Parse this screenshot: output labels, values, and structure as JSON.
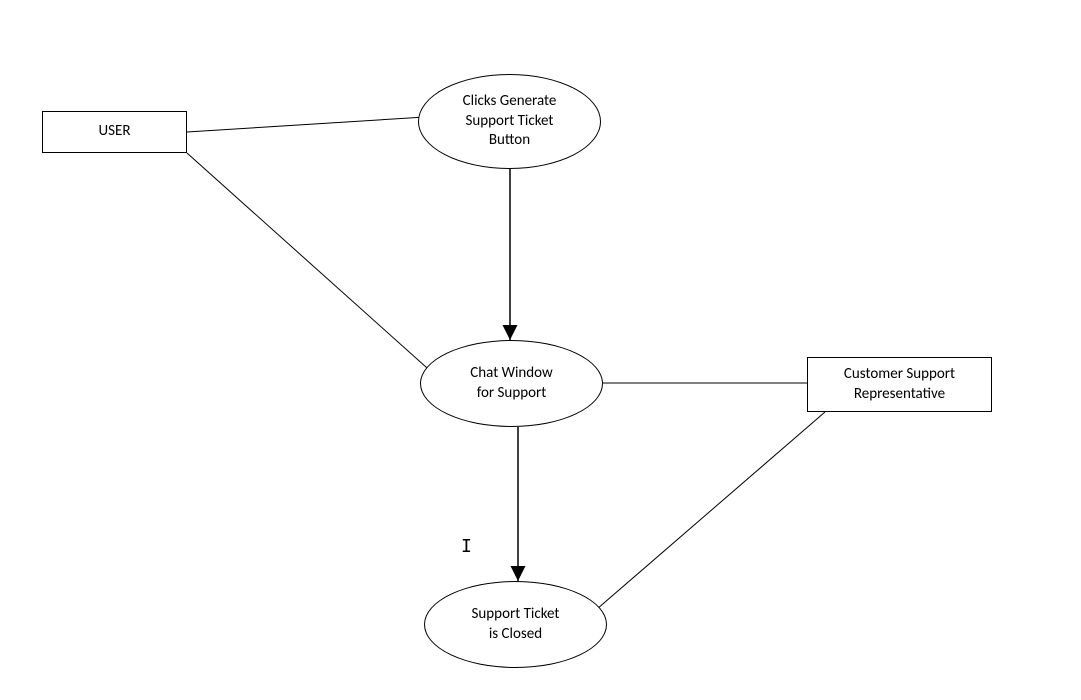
{
  "nodes": {
    "user": {
      "label": "USER"
    },
    "clicks_generate": {
      "line1": "Clicks Generate",
      "line2": "Support Ticket",
      "line3": "Button"
    },
    "chat_window": {
      "line1": "Chat Window",
      "line2": "for Support"
    },
    "customer_rep": {
      "line1": "Customer Support",
      "line2": "Representative"
    },
    "ticket_closed": {
      "line1": "Support Ticket",
      "line2": "is Closed"
    }
  },
  "chart_data": {
    "type": "flowchart",
    "nodes": [
      {
        "id": "user",
        "shape": "rectangle",
        "label": "USER"
      },
      {
        "id": "clicks_generate",
        "shape": "ellipse",
        "label": "Clicks Generate Support Ticket Button"
      },
      {
        "id": "chat_window",
        "shape": "ellipse",
        "label": "Chat Window for Support"
      },
      {
        "id": "customer_rep",
        "shape": "rectangle",
        "label": "Customer Support Representative"
      },
      {
        "id": "ticket_closed",
        "shape": "ellipse",
        "label": "Support Ticket is Closed"
      }
    ],
    "edges": [
      {
        "from": "user",
        "to": "clicks_generate",
        "arrow": false
      },
      {
        "from": "user",
        "to": "chat_window",
        "arrow": false
      },
      {
        "from": "clicks_generate",
        "to": "chat_window",
        "arrow": true
      },
      {
        "from": "chat_window",
        "to": "customer_rep",
        "arrow": false
      },
      {
        "from": "chat_window",
        "to": "ticket_closed",
        "arrow": true
      },
      {
        "from": "customer_rep",
        "to": "ticket_closed",
        "arrow": false
      }
    ]
  }
}
